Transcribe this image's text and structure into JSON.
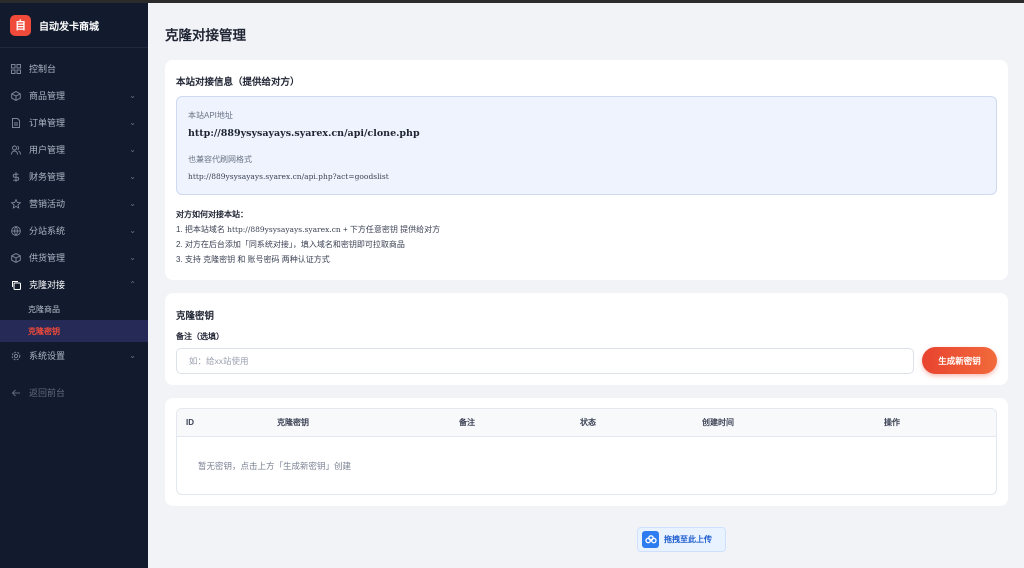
{
  "brand": {
    "logo_char": "自",
    "title": "自动发卡商城"
  },
  "sidebar": {
    "items": [
      {
        "label": "控制台",
        "icon": "dashboard-icon"
      },
      {
        "label": "商品管理",
        "icon": "box-icon"
      },
      {
        "label": "订单管理",
        "icon": "document-icon"
      },
      {
        "label": "用户管理",
        "icon": "users-icon"
      },
      {
        "label": "财务管理",
        "icon": "dollar-icon"
      },
      {
        "label": "营销活动",
        "icon": "star-icon"
      },
      {
        "label": "分站系统",
        "icon": "globe-icon"
      },
      {
        "label": "供货管理",
        "icon": "package-icon"
      },
      {
        "label": "克隆对接",
        "icon": "copy-icon"
      }
    ],
    "sub_items": [
      "克隆商品",
      "克隆密钥"
    ],
    "settings": "系统设置",
    "back": "返回前台"
  },
  "page": {
    "title": "克隆对接管理"
  },
  "site_info": {
    "title": "本站对接信息（提供给对方）",
    "api_label": "本站API地址",
    "api_url": "http://889ysysayays.syarex.cn/api/clone.php",
    "compat_label": "也兼容代刷网格式",
    "compat_url": "http://889ysysayays.syarex.cn/api.php?act=goodslist",
    "howto_title": "对方如何对接本站：",
    "step1_prefix": "1. 把本站域名 ",
    "step1_domain": "http://889ysysayays.syarex.cn",
    "step1_suffix": " + 下方任意密钥 提供给对方",
    "step2": "2. 对方在后台添加「同系统对接」，填入域名和密钥即可拉取商品",
    "step3": "3. 支持 克隆密钥 和 账号密码 两种认证方式"
  },
  "keys": {
    "title": "克隆密钥",
    "note_label": "备注（选填）",
    "note_placeholder": "如：给xx站使用",
    "note_value": "",
    "generate_button": "生成新密钥"
  },
  "table": {
    "columns": [
      "ID",
      "克隆密钥",
      "备注",
      "状态",
      "创建时间",
      "操作"
    ],
    "rows": [],
    "empty_text": "暂无密钥，点击上方「生成新密钥」创建"
  },
  "upload": {
    "label": "拖拽至此上传"
  },
  "colors": {
    "sidebar_bg": "#121b2e",
    "accent": "#ef4a3a",
    "active_sub_bg": "#262a56",
    "info_bg": "#eef3fd",
    "upload_blue": "#2d7cf0"
  }
}
